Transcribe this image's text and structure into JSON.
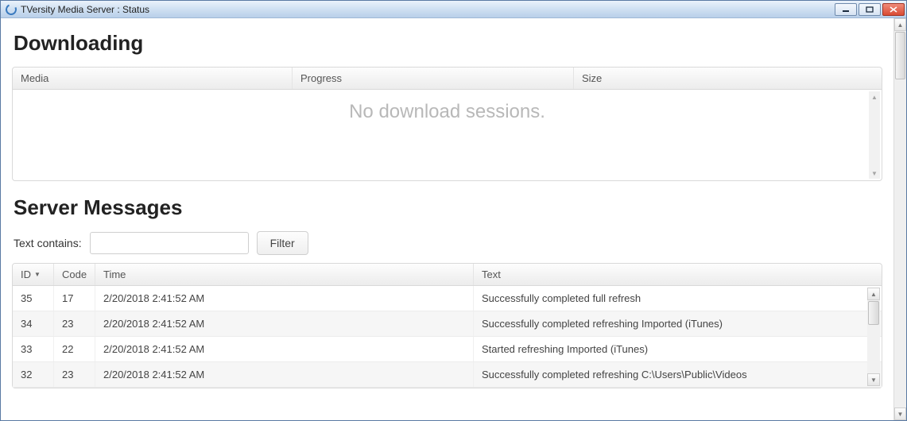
{
  "window": {
    "title": "TVersity Media Server : Status"
  },
  "sections": {
    "downloading": {
      "heading": "Downloading",
      "columns": {
        "media": "Media",
        "progress": "Progress",
        "size": "Size"
      },
      "empty_message": "No download sessions."
    },
    "server_messages": {
      "heading": "Server Messages",
      "filter": {
        "label": "Text contains:",
        "value": "",
        "button": "Filter"
      },
      "columns": {
        "id": "ID",
        "code": "Code",
        "time": "Time",
        "text": "Text"
      },
      "sort": {
        "column": "id",
        "direction": "desc"
      },
      "rows": [
        {
          "id": "35",
          "code": "17",
          "time": "2/20/2018 2:41:52 AM",
          "text": "Successfully completed full refresh"
        },
        {
          "id": "34",
          "code": "23",
          "time": "2/20/2018 2:41:52 AM",
          "text": "Successfully completed refreshing Imported (iTunes)"
        },
        {
          "id": "33",
          "code": "22",
          "time": "2/20/2018 2:41:52 AM",
          "text": "Started refreshing Imported (iTunes)"
        },
        {
          "id": "32",
          "code": "23",
          "time": "2/20/2018 2:41:52 AM",
          "text": "Successfully completed refreshing C:\\Users\\Public\\Videos"
        }
      ]
    }
  }
}
